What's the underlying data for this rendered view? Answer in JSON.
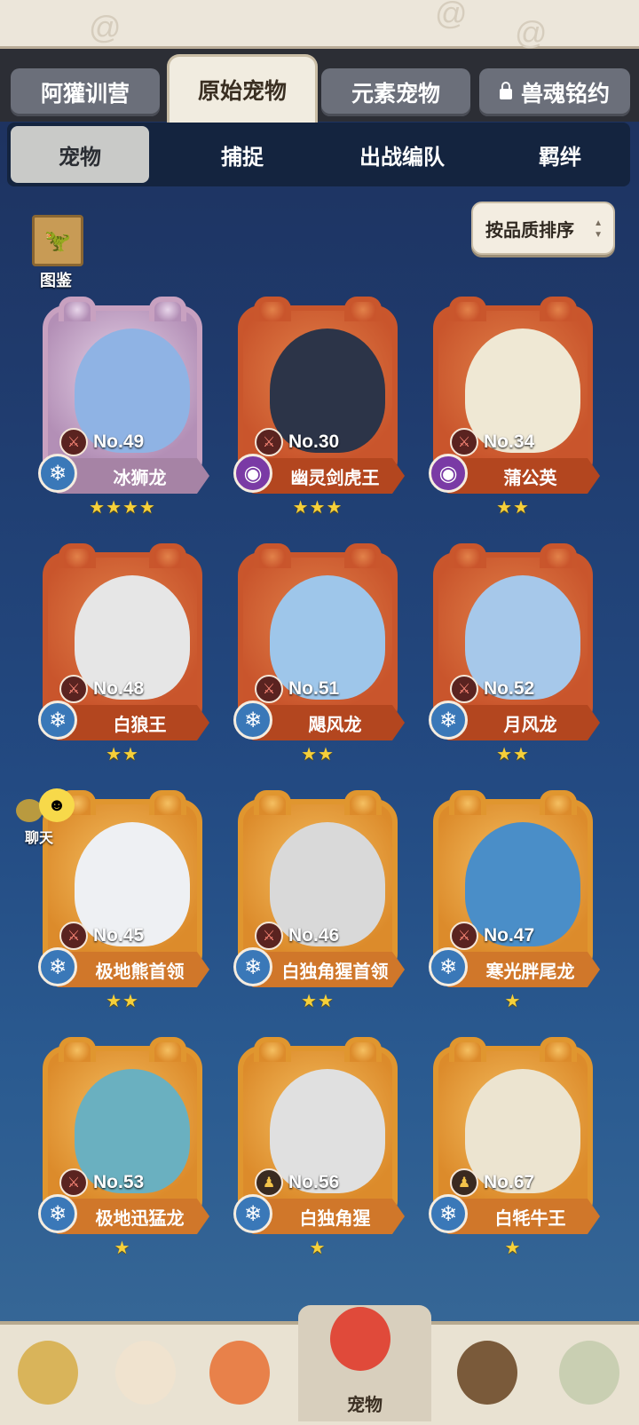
{
  "tabs_top": [
    {
      "label": "阿獾训营"
    },
    {
      "label": "原始宠物",
      "active": true
    },
    {
      "label": "元素宠物"
    },
    {
      "label": "兽魂铭约",
      "locked": true
    }
  ],
  "tabs_sub": [
    {
      "label": "宠物",
      "active": true
    },
    {
      "label": "捕捉"
    },
    {
      "label": "出战编队"
    },
    {
      "label": "羁绊"
    }
  ],
  "sort_label": "按品质排序",
  "codex_label": "图鉴",
  "chat_label": "聊天",
  "pets": [
    {
      "no": "No.49",
      "name": "冰狮龙",
      "stars": "★★★★",
      "elem": "snowflake-icon"
    },
    {
      "no": "No.30",
      "name": "幽灵剑虎王",
      "stars": "★★★",
      "elem": "ghost-flame-icon"
    },
    {
      "no": "No.34",
      "name": "蒲公英",
      "stars": "★★",
      "elem": "ghost-flame-icon"
    },
    {
      "no": "No.48",
      "name": "白狼王",
      "stars": "★★",
      "elem": "snowflake-icon"
    },
    {
      "no": "No.51",
      "name": "飓风龙",
      "stars": "★★",
      "elem": "snowflake-icon"
    },
    {
      "no": "No.52",
      "name": "月风龙",
      "stars": "★★",
      "elem": "snowflake-icon"
    },
    {
      "no": "No.45",
      "name": "极地熊首领",
      "stars": "★★",
      "elem": "snowflake-icon"
    },
    {
      "no": "No.46",
      "name": "白独角猩首领",
      "stars": "★★",
      "elem": "snowflake-icon"
    },
    {
      "no": "No.47",
      "name": "寒光胖尾龙",
      "stars": "★",
      "elem": "snowflake-icon"
    },
    {
      "no": "No.53",
      "name": "极地迅猛龙",
      "stars": "★",
      "elem": "snowflake-icon"
    },
    {
      "no": "No.56",
      "name": "白独角猩",
      "stars": "★",
      "elem": "snowflake-icon"
    },
    {
      "no": "No.67",
      "name": "白牦牛王",
      "stars": "★",
      "elem": "snowflake-icon"
    }
  ],
  "bottom_nav_active_label": "宠物"
}
